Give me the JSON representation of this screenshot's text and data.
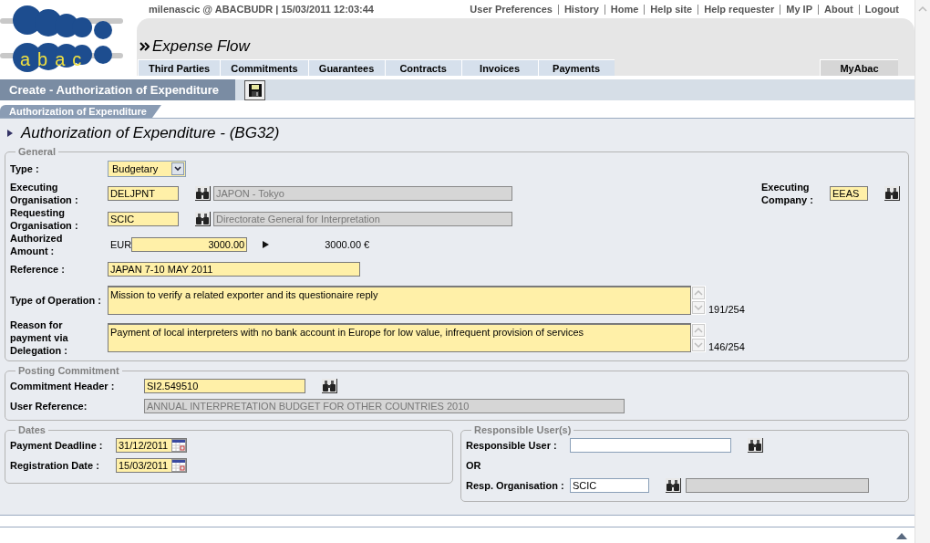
{
  "logo_text": "abac",
  "header": {
    "user_info": "milenascic @ ABACBUDR | 15/03/2011 12:03:44",
    "links": [
      "User Preferences",
      "History",
      "Home",
      "Help site",
      "Help requester",
      "My IP",
      "About",
      "Logout"
    ],
    "module_title": "Expense Flow",
    "tabs": [
      {
        "label": "Third Parties",
        "kind": "module",
        "selected": false
      },
      {
        "label": "Commitments",
        "kind": "module",
        "selected": false
      },
      {
        "label": "Guarantees",
        "kind": "module",
        "selected": false
      },
      {
        "label": "Contracts",
        "kind": "module",
        "selected": false
      },
      {
        "label": "Invoices",
        "kind": "module",
        "selected": false
      },
      {
        "label": "Payments",
        "kind": "module",
        "selected": false
      },
      {
        "label": "MyAbac",
        "kind": "personal",
        "selected": false
      }
    ]
  },
  "action_bar": {
    "title": "Create - Authorization of Expenditure"
  },
  "breadcrumb": "Authorization of Expenditure",
  "heading": "Authorization of Expenditure - (BG32)",
  "general": {
    "legend": "General",
    "type": {
      "label": "Type :",
      "value": "Budgetary"
    },
    "executing_org": {
      "label": "Executing\nOrganisation :",
      "value": "DELJPNT",
      "required": true,
      "description": "JAPON - Tokyo"
    },
    "executing_company": {
      "label": "Executing\nCompany :",
      "value": "EEAS",
      "required": true
    },
    "requesting_org": {
      "label": "Requesting\nOrganisation :",
      "value": "SCIC",
      "required": true,
      "description": "Directorate General for Interpretation"
    },
    "amount": {
      "label": "Authorized\nAmount :",
      "currency": "EUR",
      "value": "3000.00",
      "required": true,
      "converted": "3000.00 €"
    },
    "reference": {
      "label": "Reference :",
      "value": "JAPAN 7-10 MAY 2011",
      "required": true
    },
    "type_of_operation": {
      "label": "Type of Operation :",
      "value": "Mission to verify a related exporter and its questionaire reply",
      "required": true,
      "counter": "191/254"
    },
    "reason": {
      "label": "Reason for\npayment via\nDelegation :",
      "value": "Payment of local interpreters with no bank account in Europe for low value, infrequent provision of services",
      "required": true,
      "counter": "146/254"
    }
  },
  "posting": {
    "legend": "Posting Commitment",
    "commitment_header": {
      "label": "Commitment Header :",
      "value": "SI2.549510",
      "required": true
    },
    "user_reference": {
      "label": "User Reference:",
      "description": "ANNUAL INTERPRETATION BUDGET FOR OTHER COUNTRIES 2010"
    }
  },
  "dates": {
    "legend": "Dates",
    "fields": [
      {
        "label": "Payment Deadline :",
        "value": "31/12/2011",
        "required": true
      },
      {
        "label": "Registration Date :",
        "value": "15/03/2011",
        "required": true
      }
    ]
  },
  "responsible": {
    "legend": "Responsible User(s)",
    "user": {
      "label": "Responsible User :",
      "required": false
    },
    "or_text": "OR",
    "organisation": {
      "label": "Resp. Organisation :",
      "value": "SCIC",
      "required": false
    }
  }
}
